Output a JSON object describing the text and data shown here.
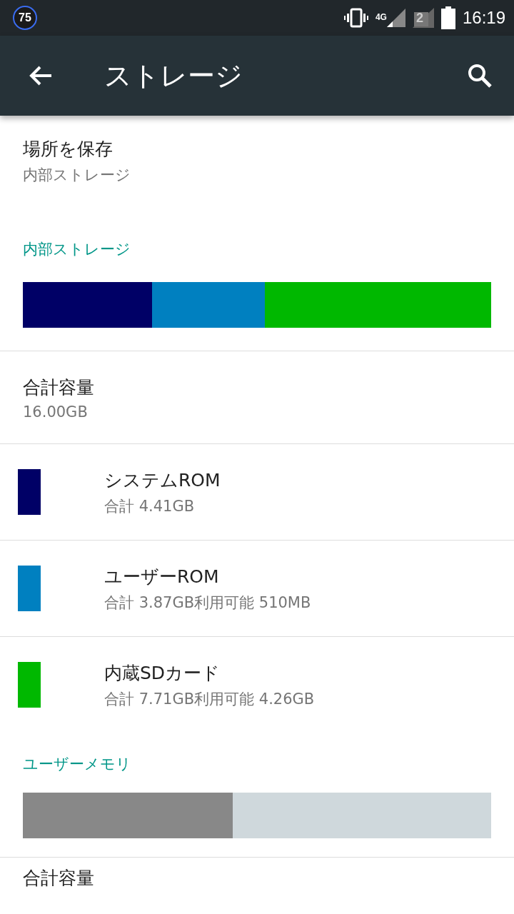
{
  "status_bar": {
    "notification_badge": "75",
    "network": "4G",
    "sim_label": "2",
    "time": "16:19"
  },
  "app_bar": {
    "title": "ストレージ"
  },
  "save_location": {
    "title": "場所を保存",
    "value": "内部ストレージ"
  },
  "internal_storage": {
    "header": "内部ストレージ",
    "segments": [
      {
        "color": "#000066"
      },
      {
        "color": "#0080c0"
      },
      {
        "color": "#00b800"
      }
    ],
    "total": {
      "title": "合計容量",
      "value": "16.00GB"
    },
    "items": [
      {
        "title": "システムROM",
        "detail": "合計 4.41GB",
        "color": "#000066"
      },
      {
        "title": "ユーザーROM",
        "detail": "合計 3.87GB利用可能 510MB",
        "color": "#0080c0"
      },
      {
        "title": "内蔵SDカード",
        "detail": "合計 7.71GB利用可能 4.26GB",
        "color": "#00b800"
      }
    ]
  },
  "user_memory": {
    "header": "ユーザーメモリ",
    "level": 0.448,
    "total_title": "合計容量"
  }
}
